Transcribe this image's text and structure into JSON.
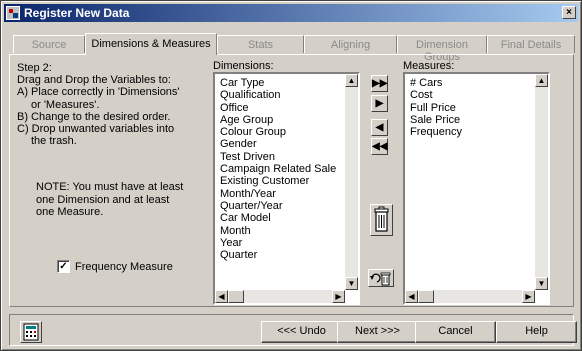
{
  "window": {
    "title": "Register New Data",
    "close_label": "×"
  },
  "tabs": [
    {
      "label": "Source",
      "active": false
    },
    {
      "label": "Dimensions & Measures",
      "active": true
    },
    {
      "label": "Stats",
      "active": false
    },
    {
      "label": "Aligning",
      "active": false
    },
    {
      "label": "Dimension Groups",
      "active": false
    },
    {
      "label": "Final Details",
      "active": false
    }
  ],
  "instructions": {
    "step": "Step 2:",
    "line1": "Drag and Drop the Variables to:",
    "line2": "A) Place correctly in 'Dimensions'",
    "line3": "or 'Measures'.",
    "line4": "B) Change to the desired order.",
    "line5": "C) Drop unwanted variables into",
    "line6": "the trash."
  },
  "note": {
    "line1": "NOTE: You must have at least",
    "line2": "one Dimension and at least",
    "line3": "one Measure."
  },
  "frequency_checkbox": {
    "label": "Frequency Measure",
    "checked": true,
    "mark": "✓"
  },
  "dimensions": {
    "label": "Dimensions:",
    "items": [
      "Car Type",
      "Qualification",
      "Office",
      "Age Group",
      "Colour Group",
      "Gender",
      "Test Driven",
      "Campaign Related Sale",
      "Existing Customer",
      "Month/Year",
      "Quarter/Year",
      "Car Model",
      "Month",
      "Year",
      "Quarter"
    ]
  },
  "measures": {
    "label": "Measures:",
    "items": [
      "# Cars",
      "Cost",
      "Full Price",
      "Sale Price",
      "Frequency"
    ]
  },
  "move_buttons": {
    "move_all_right": "▶▶",
    "move_right": "▶",
    "move_left": "◀",
    "move_all_left": "◀◀"
  },
  "buttons": {
    "undo": "<<< Undo",
    "next": "Next >>>",
    "cancel": "Cancel",
    "help": "Help"
  },
  "icons": {
    "app": "app-icon",
    "trash": "trash-icon",
    "restore": "undo-trash-icon",
    "calculator": "calculator-icon"
  }
}
